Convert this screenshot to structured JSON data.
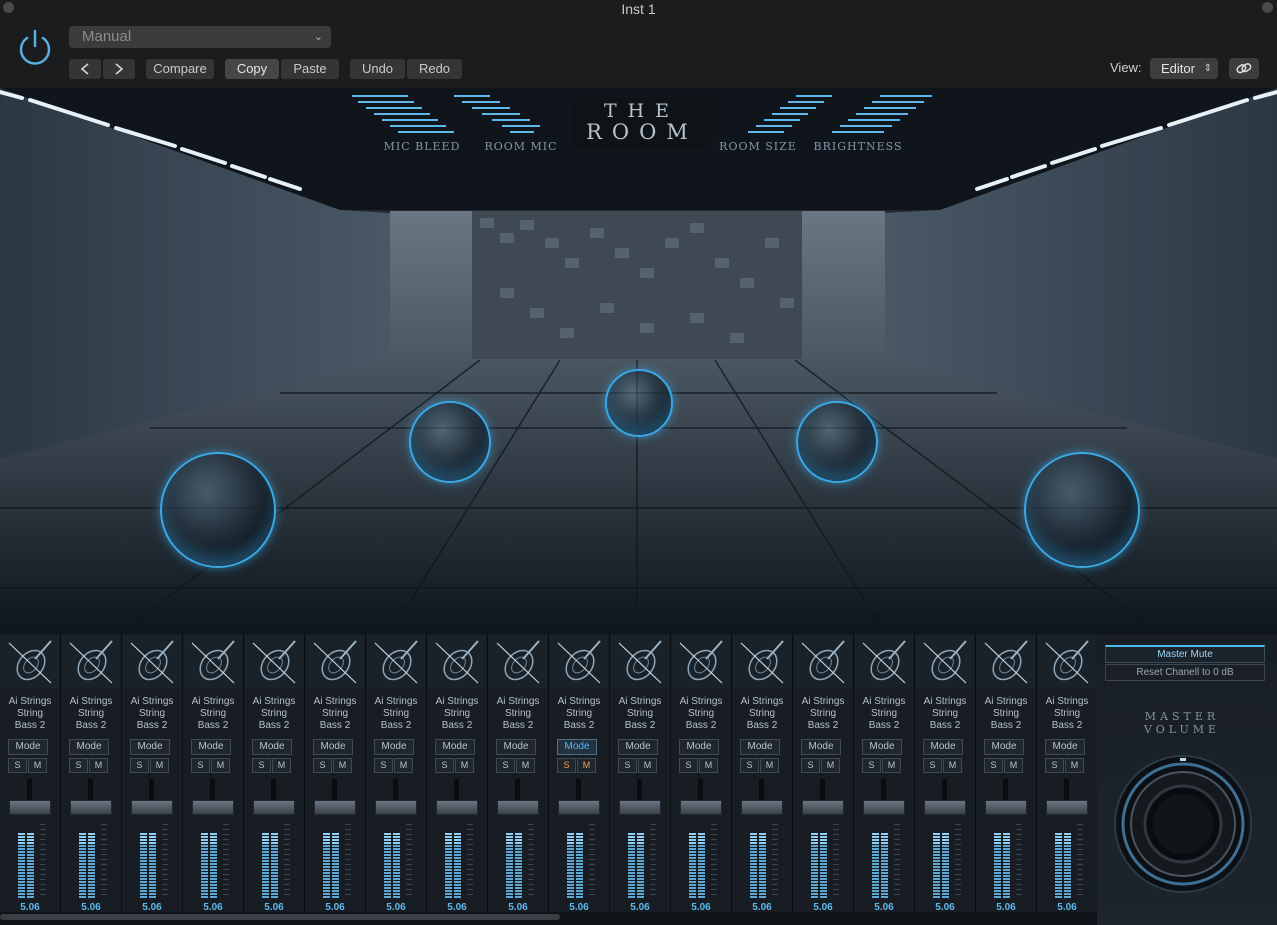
{
  "window": {
    "title": "Inst 1"
  },
  "header": {
    "preset": "Manual",
    "buttons": {
      "compare": "Compare",
      "copy": "Copy",
      "paste": "Paste",
      "undo": "Undo",
      "redo": "Redo"
    },
    "view_label": "View:",
    "view_value": "Editor"
  },
  "plugin": {
    "logo_top": "THE",
    "logo_bottom": "ROOM",
    "controls": [
      "MIC BLEED",
      "ROOM MIC",
      "ROOM SIZE",
      "BRIGHTNESS"
    ]
  },
  "mixer": {
    "channel_name_line1": "Ai Strings",
    "channel_name_line2": "String",
    "channel_name_line3": "Bass 2",
    "mode_label": "Mode",
    "solo_label": "S",
    "mute_label": "M",
    "value": "5.06",
    "channel_count": 18,
    "selected_channel_index": 9,
    "master_mute": "Master Mute",
    "reset": "Reset Chanell to 0 dB",
    "master_volume_line1": "MASTER",
    "master_volume_line2": "VOLUME"
  },
  "colors": {
    "accent": "#4db8f0",
    "solo_active": "#f0a050"
  }
}
